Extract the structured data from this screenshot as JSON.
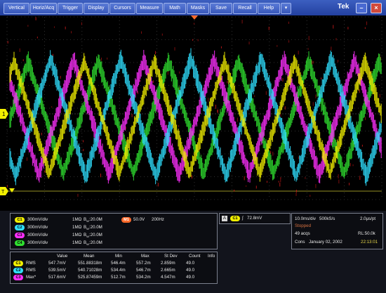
{
  "menu": {
    "items": [
      "Vertical",
      "Horiz/Acq",
      "Trigger",
      "Display",
      "Cursors",
      "Measure",
      "Math",
      "Masks",
      "Save",
      "Recall",
      "Help"
    ],
    "dropdown_glyph": "▾",
    "brand": "Tek"
  },
  "colors": {
    "ch1": "#f2f000",
    "ch2": "#30e0ff",
    "ch3": "#ff30ff",
    "ch4": "#30e030",
    "math": "#ff6a2a"
  },
  "markers": {
    "ch_ground": "1",
    "trigger": "T"
  },
  "channels": [
    {
      "badge": "C1",
      "scale": "300mV/div",
      "coupling": "1MΩ",
      "bw": "B",
      "bw_sub": "W",
      "bw_value": ":20.0M"
    },
    {
      "badge": "C2",
      "scale": "300mV/div",
      "coupling": "1MΩ",
      "bw": "B",
      "bw_sub": "W",
      "bw_value": ":20.0M"
    },
    {
      "badge": "C3",
      "scale": "300mV/div",
      "coupling": "1MΩ",
      "bw": "B",
      "bw_sub": "W",
      "bw_value": ":20.0M"
    },
    {
      "badge": "C4",
      "scale": "300mV/div",
      "coupling": "1MΩ",
      "bw": "B",
      "bw_sub": "W",
      "bw_value": ":20.0M"
    }
  ],
  "math": {
    "badge": "M1",
    "scale": "50.0V",
    "freq": "200Hz"
  },
  "trigger": {
    "mode": "A",
    "channel": "C1",
    "slope": "∫",
    "level": "72.8mV"
  },
  "acquisition": {
    "timebase": "10.0ms/div",
    "samplerate": "500kS/s",
    "resolution": "2.0μs/pt",
    "state": "Stopped",
    "acqs": "49 acqs",
    "record_length": "RL:50.0k",
    "label": "Cons",
    "date": "January 02, 2002",
    "time": "22:13:01"
  },
  "measurements": {
    "headers": [
      "Value",
      "Mean",
      "Min",
      "Max",
      "St Dev",
      "Count",
      "Info"
    ],
    "rows": [
      {
        "badge": "C1",
        "name": "RMS",
        "values": [
          "547.7mV",
          "551.88318m",
          "546.4m",
          "557.2m",
          "2.859m",
          "49.0",
          ""
        ]
      },
      {
        "badge": "C2",
        "name": "RMS",
        "values": [
          "539.5mV",
          "540.71028m",
          "534.4m",
          "546.7m",
          "2.665m",
          "49.0",
          ""
        ]
      },
      {
        "badge": "C3",
        "name": "Max*",
        "values": [
          "517.6mV",
          "525.87459m",
          "512.7m",
          "534.2m",
          "4.547m",
          "49.0",
          ""
        ]
      }
    ]
  }
}
